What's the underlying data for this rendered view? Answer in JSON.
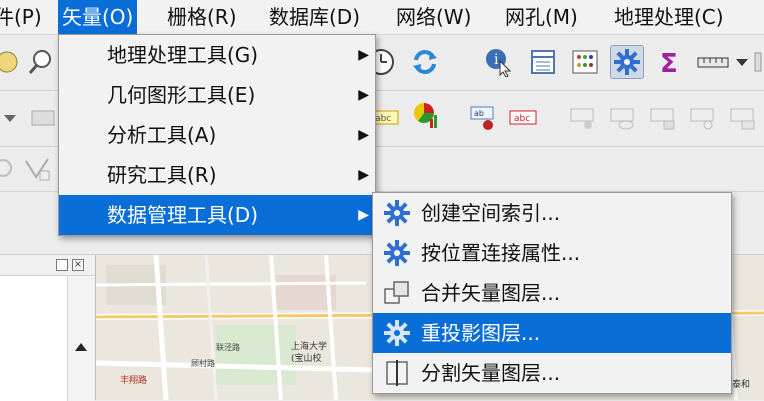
{
  "menubar": {
    "items": [
      {
        "label": "件(P)"
      },
      {
        "label": "矢量(O)"
      },
      {
        "label": "栅格(R)"
      },
      {
        "label": "数据库(D)"
      },
      {
        "label": "网络(W)"
      },
      {
        "label": "网孔(M)"
      },
      {
        "label": "地理处理(C)"
      }
    ]
  },
  "vector_menu": {
    "items": [
      {
        "label": "地理处理工具(G)",
        "has_submenu": true
      },
      {
        "label": "几何图形工具(E)",
        "has_submenu": true
      },
      {
        "label": "分析工具(A)",
        "has_submenu": true
      },
      {
        "label": "研究工具(R)",
        "has_submenu": true
      },
      {
        "label": "数据管理工具(D)",
        "has_submenu": true,
        "selected": true
      }
    ],
    "arrow_glyph": "▶"
  },
  "data_management_submenu": {
    "items": [
      {
        "label": "创建空间索引...",
        "icon": "gear-icon"
      },
      {
        "label": "按位置连接属性...",
        "icon": "gear-icon"
      },
      {
        "label": "合并矢量图层...",
        "icon": "merge-layers-icon"
      },
      {
        "label": "重投影图层...",
        "icon": "gear-icon",
        "selected": true
      },
      {
        "label": "分割矢量图层...",
        "icon": "split-layer-icon"
      }
    ]
  },
  "map": {
    "labels": [
      "上海大学",
      "(宝山校",
      "丰翔路",
      "顾村路",
      "联泾路",
      "泰和"
    ]
  },
  "colors": {
    "accent": "#0a6ed8",
    "menu_bg": "#f2f2f2",
    "gear": "#2f6fcf"
  }
}
